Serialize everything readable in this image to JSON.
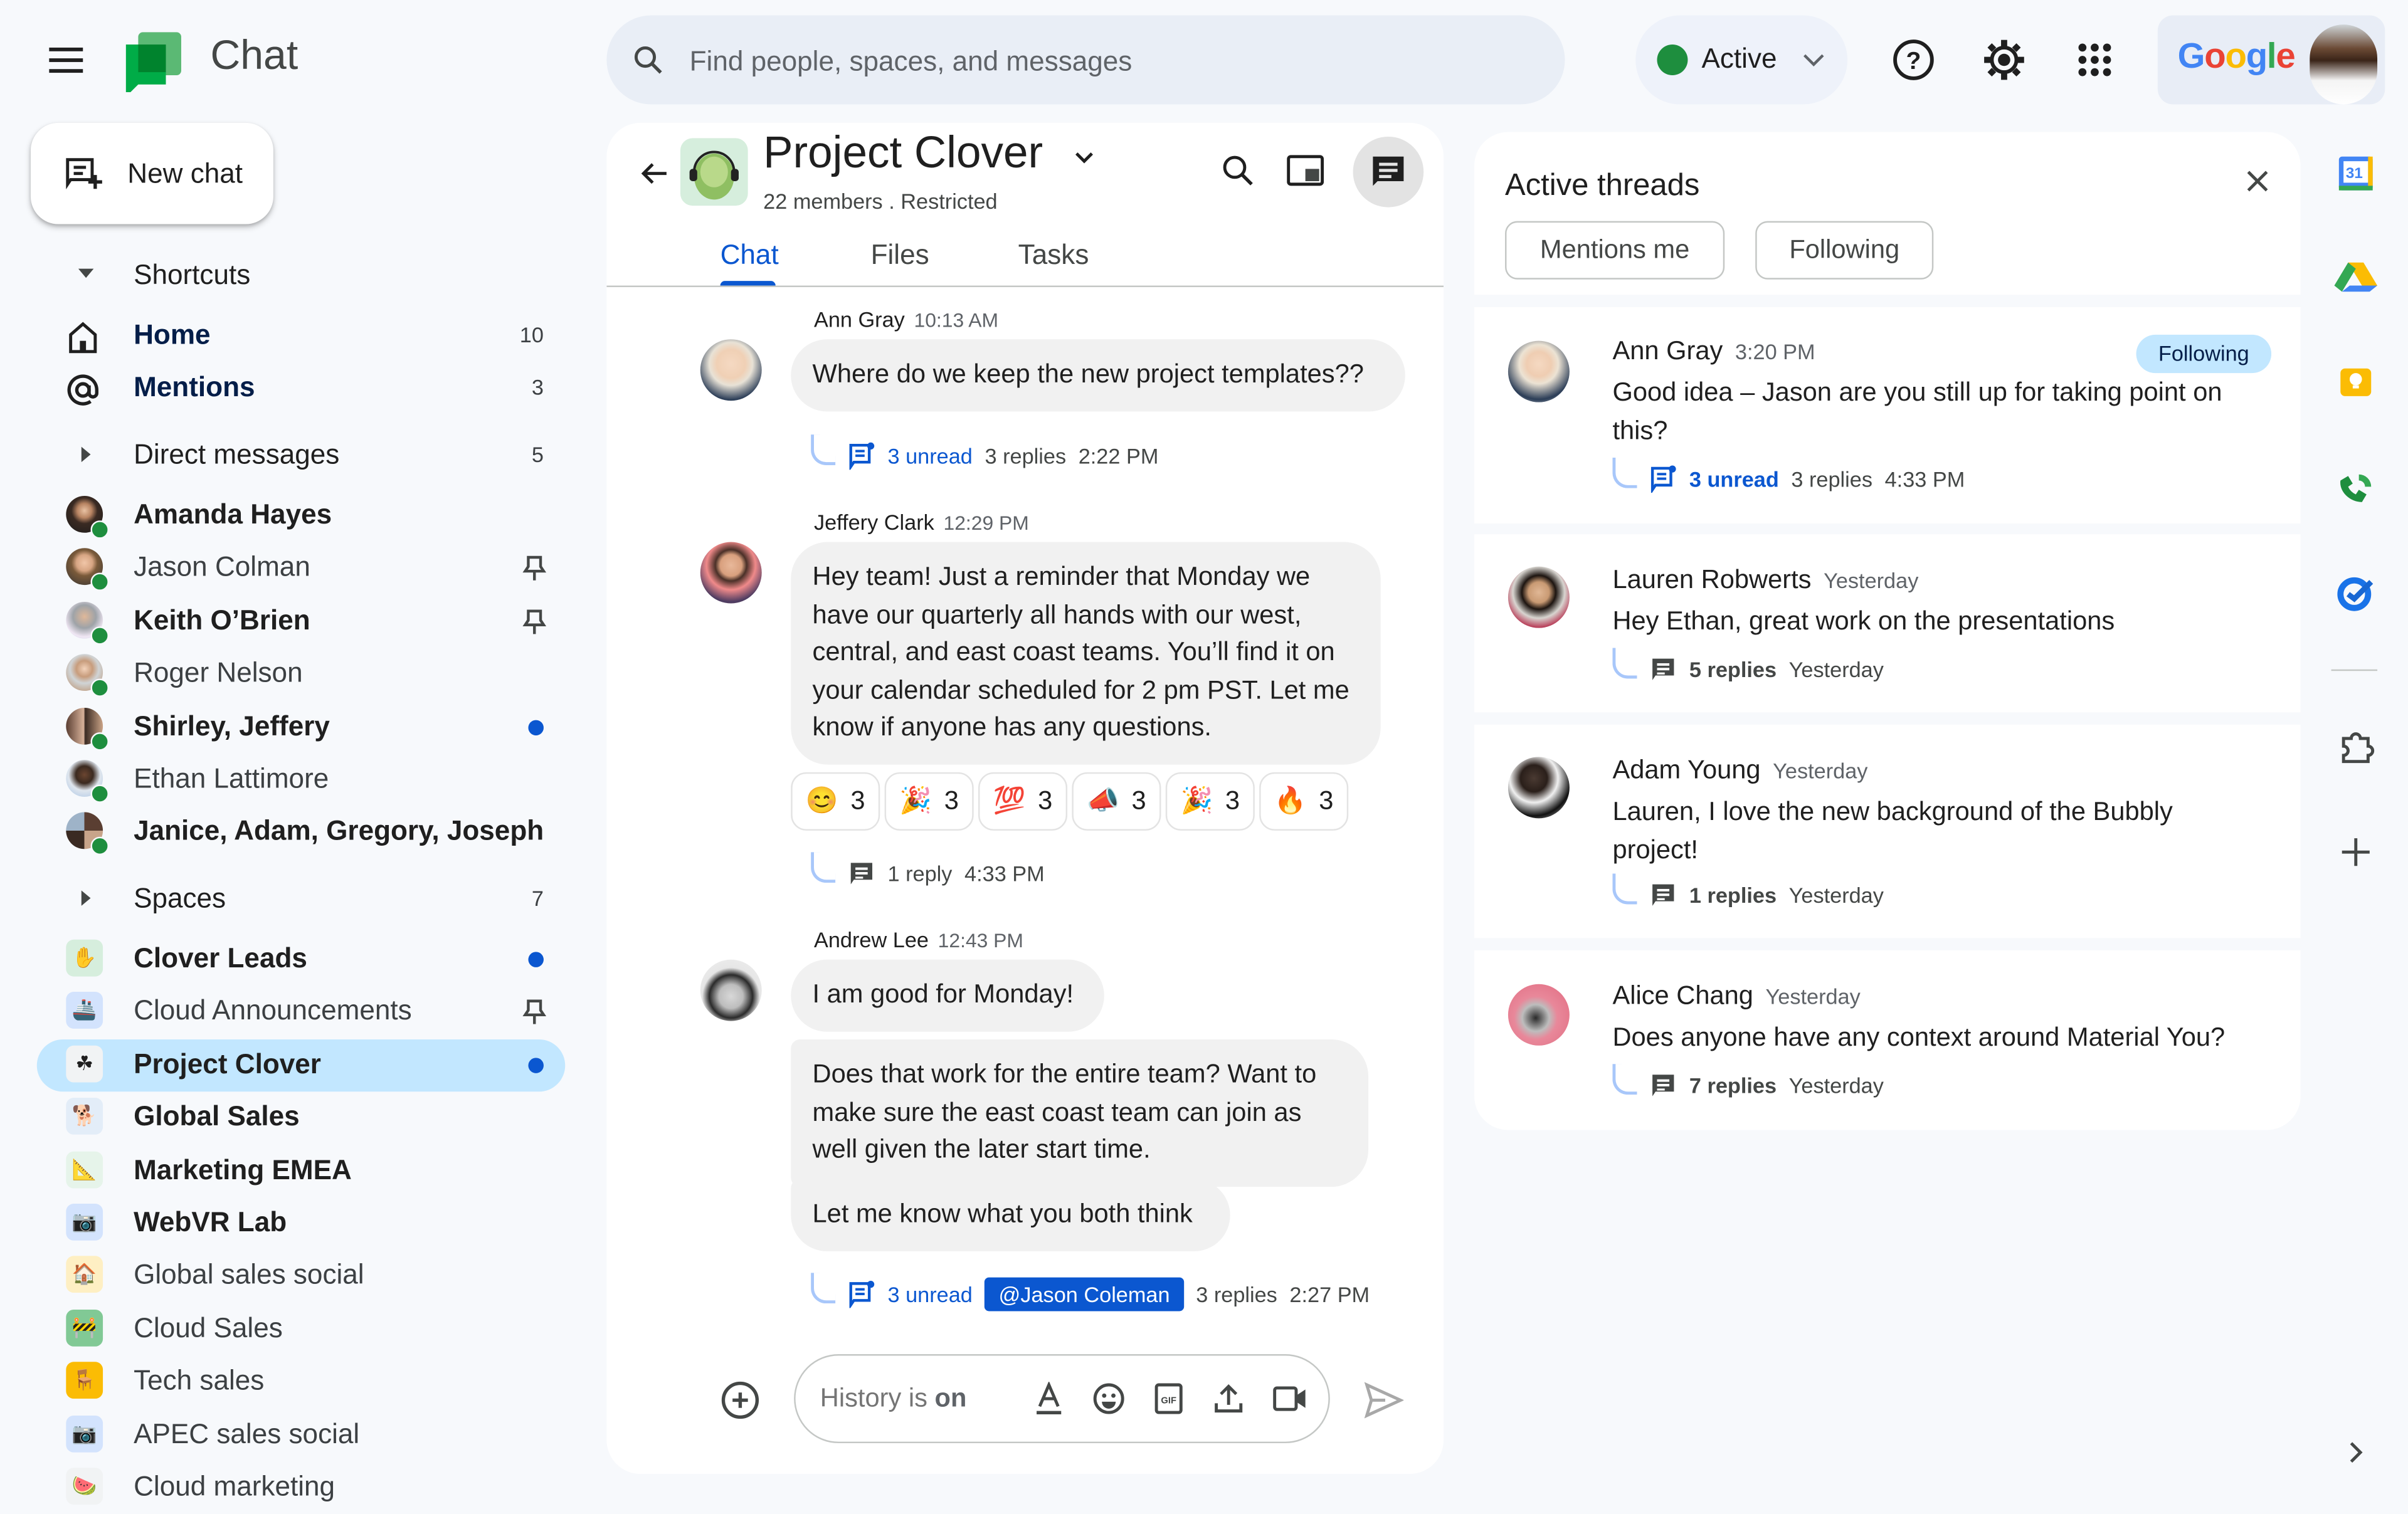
{
  "app": {
    "title": "Chat",
    "menu_icon": "hamburger-menu-icon",
    "logo_icon": "google-chat-logo"
  },
  "search": {
    "placeholder": "Find people, spaces, and messages"
  },
  "status": {
    "label": "Active",
    "color": "#1e8e3e"
  },
  "top_icons": [
    "help-icon",
    "settings-icon",
    "apps-grid-icon"
  ],
  "account": {
    "brand": "Google"
  },
  "sidebar": {
    "new_chat_label": "New chat",
    "shortcuts": {
      "label": "Shortcuts",
      "items": [
        {
          "label": "Home",
          "count": "10",
          "icon": "home-icon"
        },
        {
          "label": "Mentions",
          "count": "3",
          "icon": "at-mention-icon"
        }
      ]
    },
    "direct_messages": {
      "label": "Direct messages",
      "count": "5",
      "items": [
        {
          "label": "Amanda Hayes",
          "bold": true,
          "indicator": "",
          "online": true
        },
        {
          "label": "Jason Colman",
          "bold": false,
          "indicator": "pin",
          "online": true
        },
        {
          "label": "Keith O’Brien",
          "bold": true,
          "indicator": "pin",
          "online": true
        },
        {
          "label": "Roger Nelson",
          "bold": false,
          "indicator": "",
          "online": true
        },
        {
          "label": "Shirley, Jeffery",
          "bold": true,
          "indicator": "unread",
          "online": true
        },
        {
          "label": "Ethan Lattimore",
          "bold": false,
          "indicator": "",
          "online": true
        },
        {
          "label": "Janice, Adam, Gregory, Joseph",
          "bold": true,
          "indicator": "",
          "online": true
        }
      ]
    },
    "spaces": {
      "label": "Spaces",
      "count": "7",
      "items": [
        {
          "label": "Clover Leads",
          "bold": true,
          "indicator": "unread",
          "emoji": "✋",
          "bg": "#d6eedd",
          "selected": false
        },
        {
          "label": "Cloud Announcements",
          "bold": false,
          "indicator": "pin",
          "emoji": "🚢",
          "bg": "#d3e3fd",
          "selected": false
        },
        {
          "label": "Project Clover",
          "bold": true,
          "indicator": "unread",
          "emoji": "☘",
          "bg": "#f1f3f4",
          "selected": true
        },
        {
          "label": "Global Sales",
          "bold": true,
          "indicator": "",
          "emoji": "🐕",
          "bg": "#e3edf8",
          "selected": false
        },
        {
          "label": "Marketing EMEA",
          "bold": true,
          "indicator": "",
          "emoji": "📐",
          "bg": "#e6f4ea",
          "selected": false
        },
        {
          "label": "WebVR Lab",
          "bold": true,
          "indicator": "",
          "emoji": "📷",
          "bg": "#d3e3fd",
          "selected": false
        },
        {
          "label": "Global sales social",
          "bold": false,
          "indicator": "",
          "emoji": "🏠",
          "bg": "#feefc3",
          "selected": false
        },
        {
          "label": "Cloud Sales",
          "bold": false,
          "indicator": "",
          "emoji": "🚧",
          "bg": "#81c995",
          "selected": false
        },
        {
          "label": "Tech sales",
          "bold": false,
          "indicator": "",
          "emoji": "🪑",
          "bg": "#fbbc04",
          "selected": false
        },
        {
          "label": "APEC sales social",
          "bold": false,
          "indicator": "",
          "emoji": "📷",
          "bg": "#d3e3fd",
          "selected": false
        },
        {
          "label": "Cloud marketing",
          "bold": false,
          "indicator": "",
          "emoji": "🍉",
          "bg": "#f1f3f4",
          "selected": false
        }
      ]
    }
  },
  "chat": {
    "space_name": "Project Clover",
    "subtitle": "22 members . Restricted",
    "tabs": [
      {
        "label": "Chat",
        "active": true
      },
      {
        "label": "Files",
        "active": false
      },
      {
        "label": "Tasks",
        "active": false
      }
    ],
    "header_icons": [
      "search-icon",
      "split-view-icon",
      "threads-icon"
    ],
    "messages": [
      {
        "sender": "Ann Gray",
        "time": "10:13 AM",
        "bubbles": [
          "Where do we keep the new project templates??"
        ],
        "thread": {
          "unread": "3 unread",
          "replies": "3 replies",
          "time": "2:22 PM"
        }
      },
      {
        "sender": "Jeffery Clark",
        "time": "12:29 PM",
        "bubbles": [
          "Hey team! Just a reminder that Monday we have our quarterly all hands with our west, central, and east coast teams. You’ll find it on your calendar scheduled for 2 pm PST. Let me know if anyone has any questions."
        ],
        "reactions": [
          {
            "emoji": "😊",
            "count": "3"
          },
          {
            "emoji": "🎉",
            "count": "3"
          },
          {
            "emoji": "💯",
            "count": "3"
          },
          {
            "emoji": "📣",
            "count": "3"
          },
          {
            "emoji": "🎉",
            "count": "3"
          },
          {
            "emoji": "🔥",
            "count": "3"
          }
        ],
        "thread": {
          "replies": "1 reply",
          "time": "4:33 PM"
        }
      },
      {
        "sender": "Andrew Lee",
        "time": "12:43 PM",
        "bubbles": [
          "I am good for Monday!",
          "Does that work for the entire team? Want to make sure the east coast team can join as well given the later start time.",
          "Let me know what you both think"
        ],
        "thread": {
          "unread": "3 unread",
          "mention": "@Jason Coleman",
          "replies": "3 replies",
          "time": "2:27 PM"
        }
      }
    ],
    "compose": {
      "placeholder_prefix": "History is ",
      "placeholder_bold": "on",
      "icons": [
        "add-icon",
        "format-text-icon",
        "emoji-icon",
        "gif-icon",
        "upload-icon",
        "video-icon",
        "send-icon"
      ]
    }
  },
  "threads_panel": {
    "title": "Active threads",
    "filters": [
      "Mentions me",
      "Following"
    ],
    "threads": [
      {
        "name": "Ann Gray",
        "time": "3:20 PM",
        "badge": "Following",
        "body": "Good idea – Jason are you still up for taking point on this?",
        "unread": "3 unread",
        "replies": "3 replies",
        "reply_time": "4:33 PM"
      },
      {
        "name": "Lauren Robwerts",
        "time": "Yesterday",
        "body": "Hey Ethan, great work on the presentations",
        "replies": "5 replies",
        "reply_time": "Yesterday"
      },
      {
        "name": "Adam Young",
        "time": "Yesterday",
        "body": "Lauren, I love the new background of the Bubbly project!",
        "replies": "1 replies",
        "reply_time": "Yesterday"
      },
      {
        "name": "Alice Chang",
        "time": "Yesterday",
        "body": "Does anyone have any context around Material You?",
        "replies": "7 replies",
        "reply_time": "Yesterday"
      }
    ]
  },
  "right_rail": {
    "apps": [
      "calendar-icon",
      "drive-icon",
      "keep-icon",
      "voice-icon",
      "tasks-icon",
      "addons-icon",
      "add-app-icon"
    ],
    "calendar_day": "31"
  }
}
